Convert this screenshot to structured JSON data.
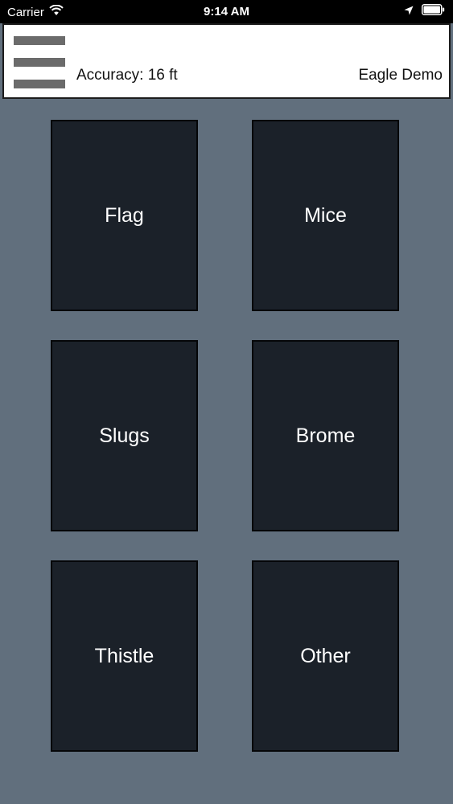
{
  "status_bar": {
    "carrier": "Carrier",
    "time": "9:14 AM",
    "icons": [
      "wifi-icon",
      "location-arrow-icon",
      "battery-icon"
    ]
  },
  "header": {
    "menu_icon": "hamburger-menu-icon",
    "accuracy": "Accuracy: 16 ft",
    "title": "Eagle Demo"
  },
  "tiles": [
    {
      "label": "Flag"
    },
    {
      "label": "Mice"
    },
    {
      "label": "Slugs"
    },
    {
      "label": "Brome"
    },
    {
      "label": "Thistle"
    },
    {
      "label": "Other"
    }
  ],
  "colors": {
    "background": "#616f7d",
    "tile": "#1b2129",
    "tile_border": "#050608",
    "header_bg": "#ffffff",
    "menu_bars": "#6b6b6b"
  }
}
